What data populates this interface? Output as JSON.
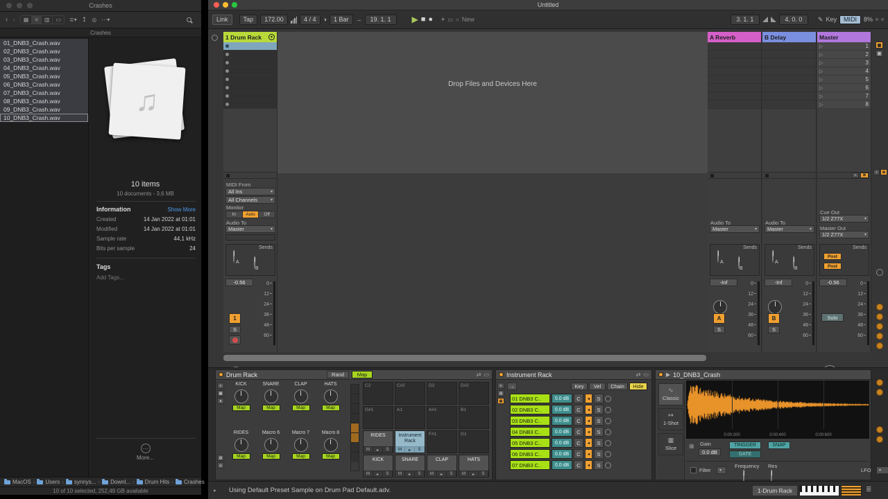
{
  "finder": {
    "window_title": "Crashes",
    "tab_label": "Crashes",
    "files": [
      "01_DNB3_Crash.wav",
      "02_DNB3_Crash.wav",
      "03_DNB3_Crash.wav",
      "04_DNB3_Crash.wav",
      "05_DNB3_Crash.wav",
      "06_DNB3_Crash.wav",
      "07_DNB3_Crash.wav",
      "08_DNB3_Crash.wav",
      "09_DNB3_Crash.wav",
      "10_DNB3_Crash.wav"
    ],
    "preview": {
      "items_count": "10 items",
      "summary": "10 documents - 3,6 MB",
      "information_title": "Information",
      "show_more_link": "Show More",
      "info_rows": [
        {
          "label": "Created",
          "value": "14 Jan 2022 at 01:01"
        },
        {
          "label": "Modified",
          "value": "14 Jan 2022 at 01:01"
        },
        {
          "label": "Sample rate",
          "value": "44,1 kHz"
        },
        {
          "label": "Bits per sample",
          "value": "24"
        }
      ],
      "tags_title": "Tags",
      "add_tags_placeholder": "Add Tags...",
      "more_label": "More..."
    },
    "path_items": [
      "MacOS",
      "Users",
      "synnys...",
      "Downl...",
      "Drum Hits",
      "Crashes"
    ],
    "status_text": "10 of 10 selected, 252,49 GB available"
  },
  "live": {
    "window_title": "Untitled",
    "transport": {
      "link": "Link",
      "tap": "Tap",
      "tempo": "172.00",
      "time_signature": "4 / 4",
      "quantize": "1 Bar",
      "position": "19. 1. 1",
      "new_label": "New",
      "loop_start": "3. 1. 1",
      "loop_length": "4. 0. 0",
      "key_label": "Key",
      "midi_label": "MIDI",
      "cpu": "8%"
    },
    "session": {
      "drop_hint": "Drop Files and Devices Here",
      "track_header": "1 Drum Rack",
      "return_a_header": "A Reverb",
      "return_b_header": "B Delay",
      "master_header": "Master",
      "scenes": [
        "1",
        "2",
        "3",
        "4",
        "5",
        "6",
        "7",
        "8"
      ],
      "midi_from": "MIDI From",
      "input_device": "All Ins",
      "input_channel": "All Channels",
      "monitor_label": "Monitor",
      "monitor_in": "In",
      "monitor_auto": "Auto",
      "monitor_off": "Off",
      "audio_to": "Audio To",
      "output_device": "Master",
      "sends_label": "Sends",
      "send_a": "A",
      "send_b": "B",
      "track_volume": "-0.56",
      "return_volume": "-Inf",
      "master_volume": "-0.56",
      "track_number": "1",
      "solo_s": "S",
      "return_a_letter": "A",
      "return_b_letter": "B",
      "meter_scale": [
        "0",
        "12",
        "24",
        "36",
        "48",
        "60"
      ],
      "cue_out": "Cue Out",
      "cue_value": "1/2 Z77X",
      "master_out": "Master Out",
      "master_out_value": "1/2 Z77X",
      "post_a": "Post",
      "post_b": "Post",
      "master_solo": "Solo"
    },
    "devices": {
      "drum_rack": {
        "title": "Drum Rack",
        "rand_button": "Rand",
        "map_button": "Map",
        "macro_names": [
          "KICK",
          "SNARE",
          "CLAP",
          "HATS",
          "RIDES",
          "Macro 6",
          "Macro 7",
          "Macro 8"
        ],
        "map_chip": "Map",
        "mute_label": "M",
        "solo_label": "S",
        "pads": [
          {
            "label": "C2",
            "state": "empty"
          },
          {
            "label": "C#2",
            "state": "empty"
          },
          {
            "label": "D2",
            "state": "empty"
          },
          {
            "label": "D#2",
            "state": "empty"
          },
          {
            "label": "G#1",
            "state": "empty"
          },
          {
            "label": "A1",
            "state": "empty"
          },
          {
            "label": "A#1",
            "state": "empty"
          },
          {
            "label": "B1",
            "state": "empty"
          },
          {
            "label": "RIDES",
            "state": "filled"
          },
          {
            "label": "Instrument Rack",
            "state": "selected"
          },
          {
            "label": "F#1",
            "state": "empty"
          },
          {
            "label": "G1",
            "state": "empty"
          },
          {
            "label": "KICK",
            "state": "filled"
          },
          {
            "label": "SNARE",
            "state": "filled"
          },
          {
            "label": "CLAP",
            "state": "filled"
          },
          {
            "label": "HATS",
            "state": "filled"
          }
        ]
      },
      "instrument_rack": {
        "title": "Instrument Rack",
        "key_button": "Key",
        "vel_button": "Vel",
        "chain_button": "Chain",
        "hide_button": "Hide",
        "chains": [
          {
            "name": "01 DNB3 C..",
            "volume": "0.0 dB",
            "pan": "C",
            "solo": "S"
          },
          {
            "name": "02 DNB3 C..",
            "volume": "0.0 dB",
            "pan": "C",
            "solo": "S"
          },
          {
            "name": "03 DNB3 C..",
            "volume": "0.0 dB",
            "pan": "C",
            "solo": "S"
          },
          {
            "name": "04 DNB3 C..",
            "volume": "0.0 dB",
            "pan": "C",
            "solo": "S"
          },
          {
            "name": "05 DNB3 C..",
            "volume": "0.0 dB",
            "pan": "C",
            "solo": "S"
          },
          {
            "name": "06 DNB3 C..",
            "volume": "0.0 dB",
            "pan": "C",
            "solo": "S"
          },
          {
            "name": "07 DNB3 C..",
            "volume": "0.0 dB",
            "pan": "C",
            "solo": "S"
          }
        ]
      },
      "sampler": {
        "title": "10_DNB3_Crash",
        "mode_classic": "Classic",
        "mode_oneshot": "1-Shot",
        "mode_slice": "Slice",
        "time_labels": [
          "0:00:200",
          "0:00:400",
          "0:00:600"
        ],
        "gain_label": "Gain",
        "gain_value": "0.0 dB",
        "trigger_button": "TRIGGER",
        "gate_button": "GATE",
        "snap_button": "SNAP",
        "filter_label": "Filter",
        "frequency_label": "Frequency",
        "res_label": "Res",
        "lfo_label": "LFO"
      }
    },
    "status_bar": {
      "message": "Using Default Preset Sample on Drum Pad Default.adv.",
      "selected_pad": "1-Drum Rack"
    }
  }
}
